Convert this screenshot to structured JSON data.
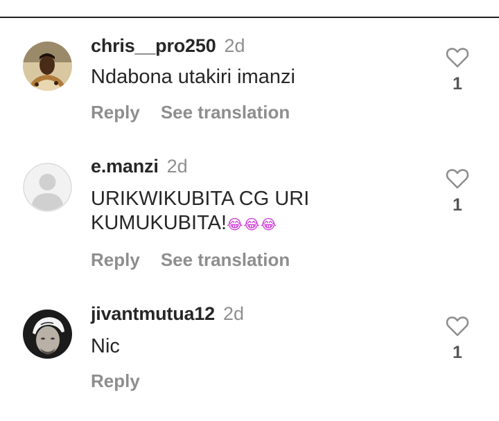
{
  "comments": [
    {
      "username": "chris__pro250",
      "time": "2d",
      "text": "Ndabona utakiri imanzi",
      "emoji": "",
      "reply_label": "Reply",
      "translate_label": "See translation",
      "likes": "1",
      "avatar": "user-photo-avatar"
    },
    {
      "username": "e.manzi",
      "time": "2d",
      "text": "URIKWIKUBITA CG URI KUMUKUBITA!",
      "emoji": "😂😂😂",
      "reply_label": "Reply",
      "translate_label": "See translation",
      "likes": "1",
      "avatar": "default-avatar"
    },
    {
      "username": "jivantmutua12",
      "time": "2d",
      "text": "Nic",
      "emoji": "",
      "reply_label": "Reply",
      "likes": "1",
      "avatar": "user-photo-avatar"
    }
  ],
  "colors": {
    "text": "#262626",
    "muted": "#8e8e8e",
    "emoji": "#d03cd8"
  }
}
